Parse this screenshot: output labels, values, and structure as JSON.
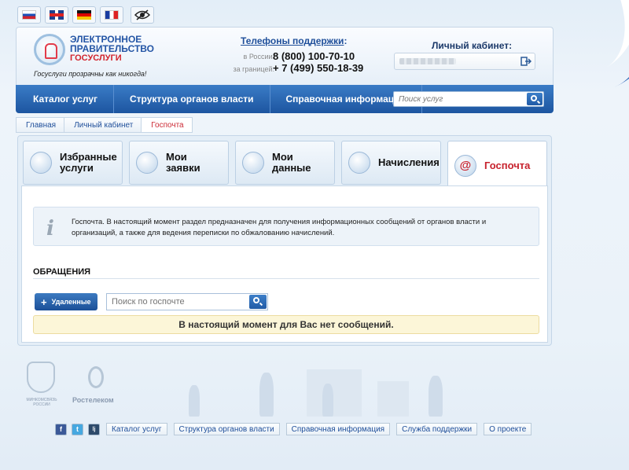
{
  "languages": [
    {
      "code": "ru",
      "icon": "flag-ru-icon"
    },
    {
      "code": "en",
      "icon": "flag-uk-icon"
    },
    {
      "code": "de",
      "icon": "flag-de-icon"
    },
    {
      "code": "fr",
      "icon": "flag-fr-icon"
    },
    {
      "code": "accessibility",
      "icon": "low-vision-icon"
    }
  ],
  "header": {
    "logo_line1": "ЭЛЕКТРОННОЕ",
    "logo_line2": "ПРАВИТЕЛЬСТВО",
    "logo_line3": "ГОСУСЛУГИ",
    "slogan": "Госуслуги прозрачны как никогда!",
    "phones_title": "Телефоны поддержки",
    "phones_colon": ":",
    "phone_ru_label": "в России:",
    "phone_ru": "8 (800) 100-70-10",
    "phone_abroad_label": "за границей:",
    "phone_abroad": "+ 7 (499) 550-18-39",
    "cabinet_title": "Личный кабинет:"
  },
  "nav": {
    "items": [
      "Каталог услуг",
      "Структура органов власти",
      "Справочная информация"
    ],
    "search_placeholder": "Поиск услуг"
  },
  "breadcrumb": [
    "Главная",
    "Личный кабинет",
    "Госпочта"
  ],
  "tabs": [
    {
      "line1": "Избранные",
      "line2": "услуги",
      "icon": "favorites-icon"
    },
    {
      "line1": "Мои",
      "line2": "заявки",
      "icon": "applications-icon"
    },
    {
      "line1": "Мои",
      "line2": "данные",
      "icon": "personal-data-icon"
    },
    {
      "line1": "Начисления",
      "line2": "",
      "icon": "charges-icon"
    },
    {
      "line1": "Госпочта",
      "line2": "",
      "icon": "at-mail-icon",
      "active": true
    }
  ],
  "info": {
    "icon": "i",
    "text": "Госпочта. В настоящий момент раздел предназначен для получения информационных сообщений от органов власти и организаций, а также для ведения переписки по обжалованию начислений."
  },
  "section": {
    "title": "ОБРАЩЕНИЯ",
    "deleted_button": "Удаленные",
    "search_placeholder": "Поиск по госпочте",
    "empty_notice": "В настоящий момент для Вас нет сообщений."
  },
  "footer": {
    "ministry_label": "МИНКОМСВЯЗЬ РОССИИ",
    "rostelecom_label": "Ростелеком",
    "social": [
      "f",
      "t",
      "lj"
    ],
    "links": [
      "Каталог услуг",
      "Структура органов власти",
      "Справочная информация",
      "Служба поддержки",
      "О проекте"
    ]
  },
  "colors": {
    "brand_blue": "#1d55a0",
    "accent_red": "#c7232e",
    "notice_bg": "#fcf6d8"
  }
}
